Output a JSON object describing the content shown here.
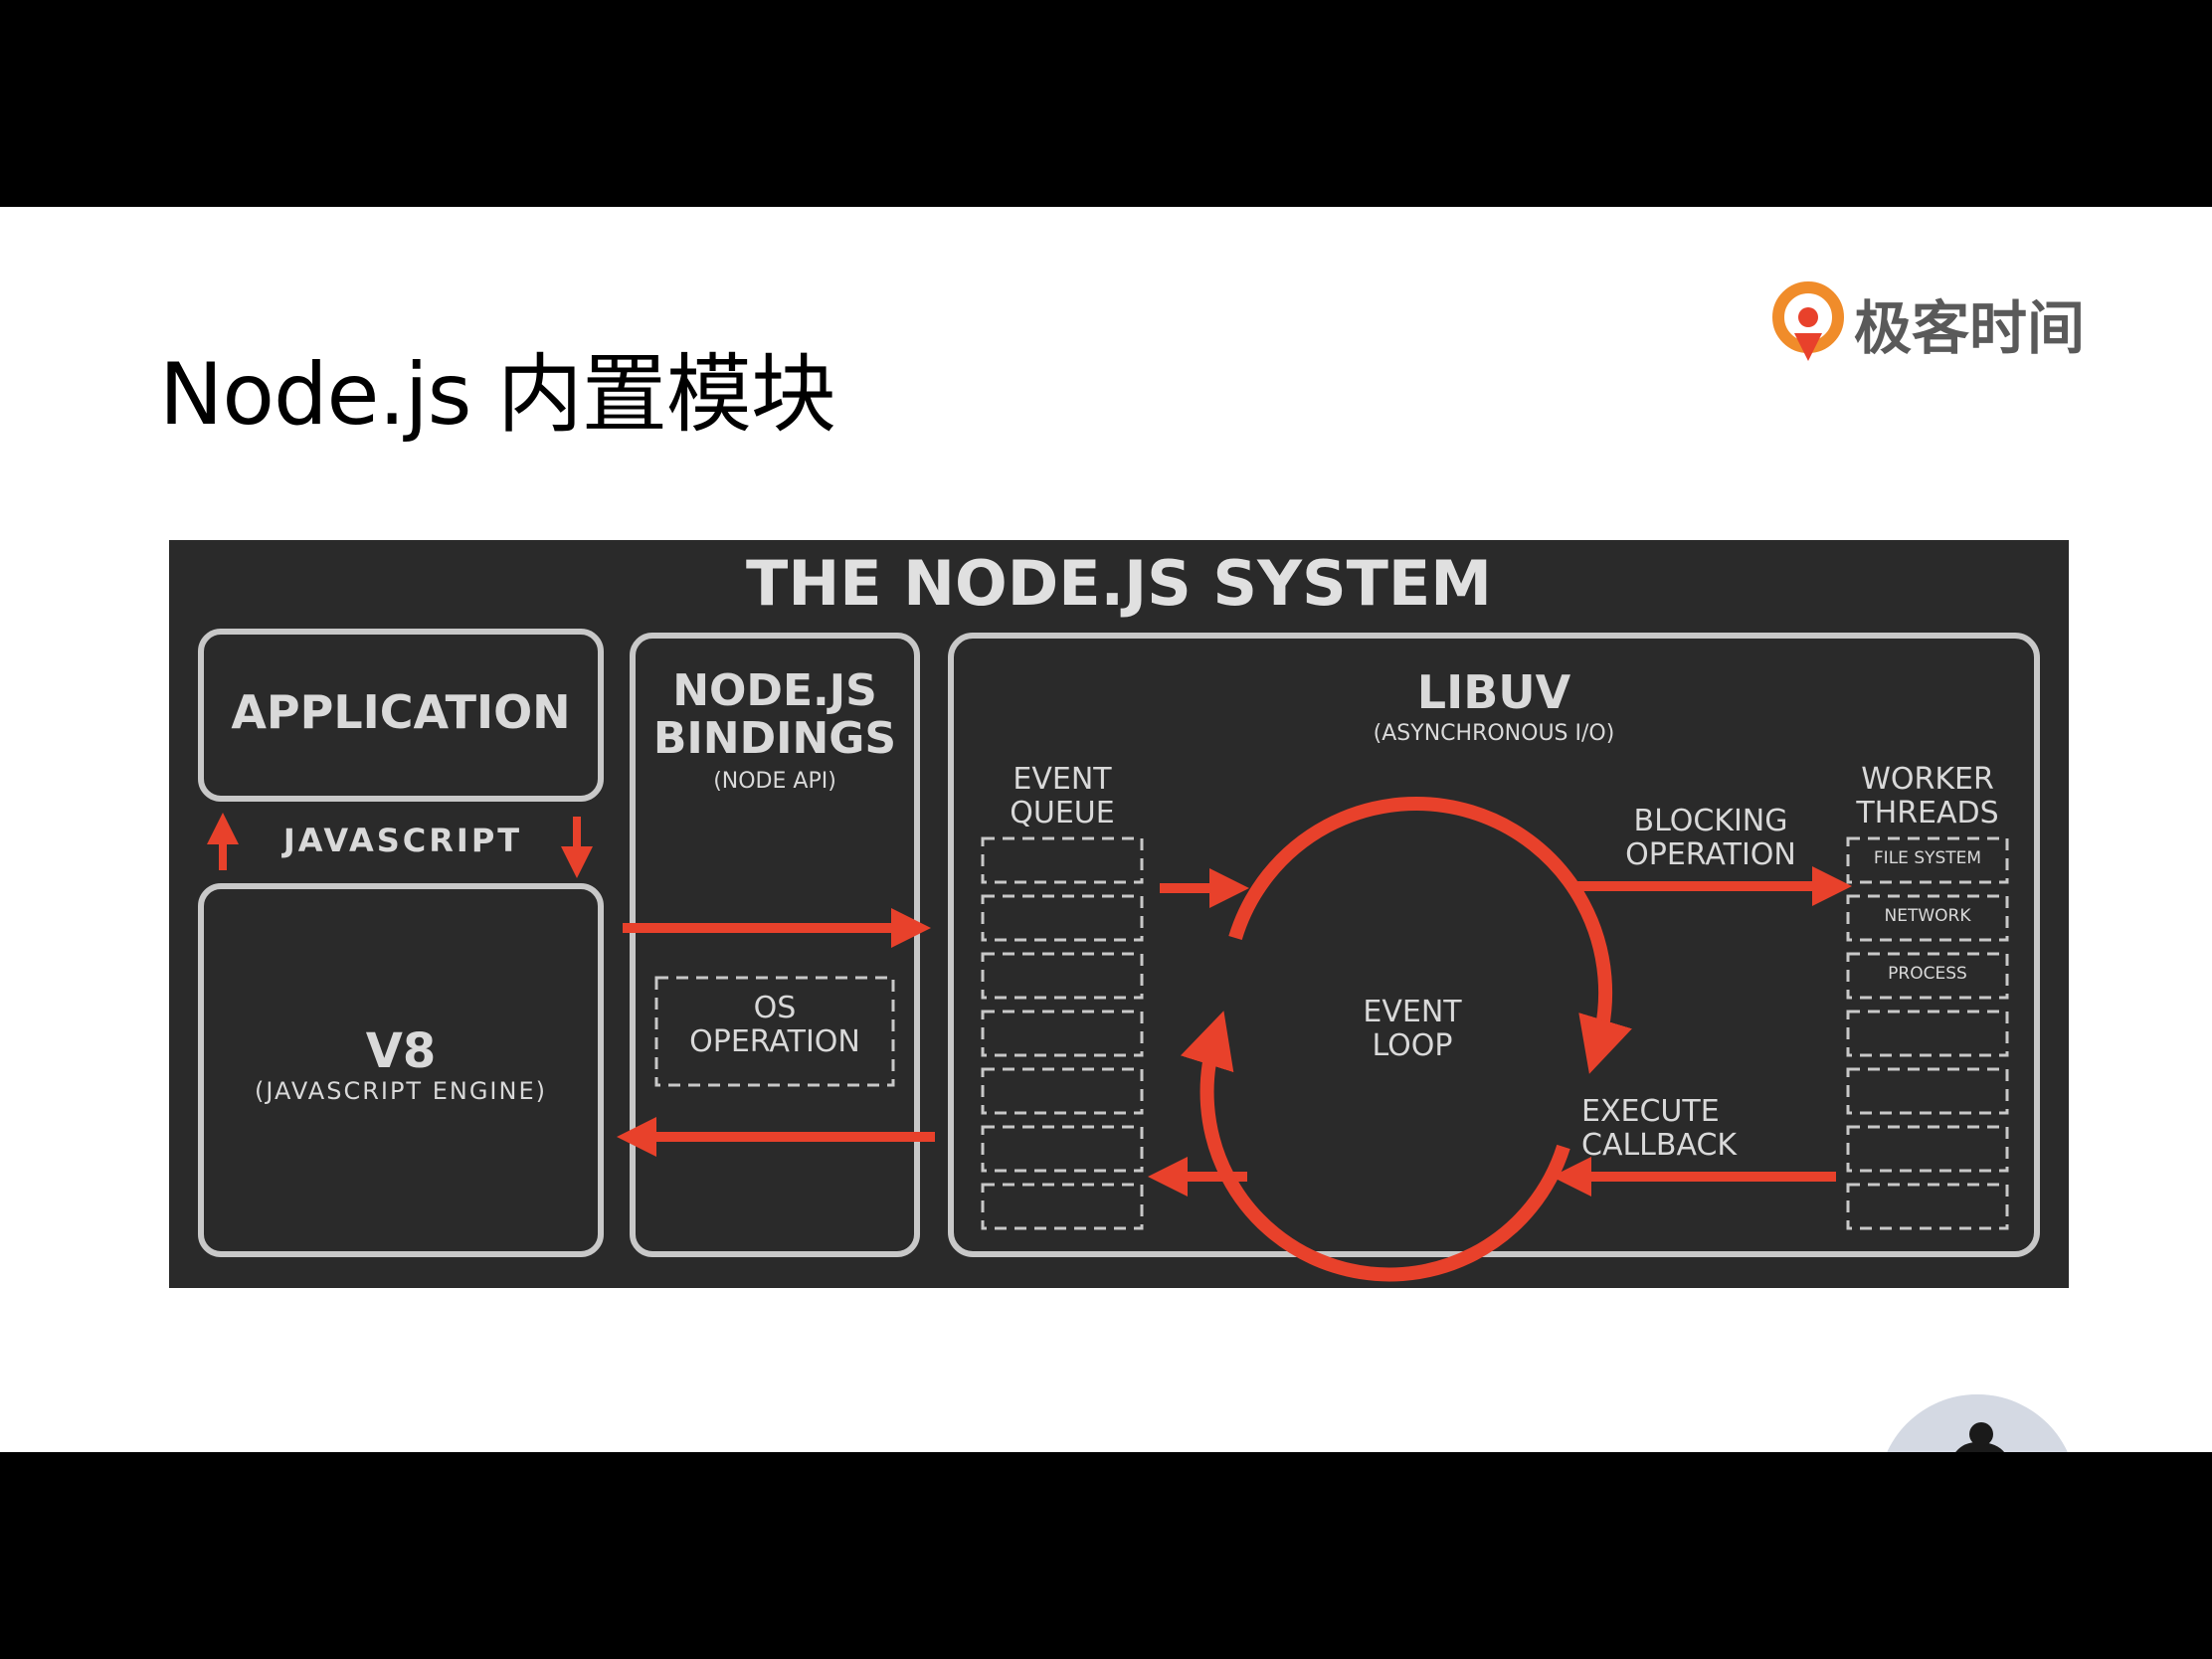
{
  "slide": {
    "title": "Node.js 内置模块",
    "brand": "极客时间"
  },
  "diagram": {
    "title": "THE NODE.JS SYSTEM",
    "application": "APPLICATION",
    "javascript": "JAVASCRIPT",
    "v8": "V8",
    "v8_sub": "(JAVASCRIPT ENGINE)",
    "bindings_line1": "NODE.JS",
    "bindings_line2": "BINDINGS",
    "bindings_sub": "(NODE API)",
    "os_line1": "OS",
    "os_line2": "OPERATION",
    "libuv": "LIBUV",
    "libuv_sub": "(ASYNCHRONOUS I/O)",
    "event_queue_line1": "EVENT",
    "event_queue_line2": "QUEUE",
    "event_loop_line1": "EVENT",
    "event_loop_line2": "LOOP",
    "blocking_line1": "BLOCKING",
    "blocking_line2": "OPERATION",
    "execute_line1": "EXECUTE",
    "execute_line2": "CALLBACK",
    "worker_line1": "WORKER",
    "worker_line2": "THREADS",
    "worker_slots": [
      "FILE SYSTEM",
      "NETWORK",
      "PROCESS"
    ]
  },
  "colors": {
    "accent": "#e8412b",
    "diagram_bg": "#2a2a2a",
    "stroke": "#c8c8c8",
    "brand_orange": "#f08c2a"
  },
  "icons": {
    "brand_logo": "geektime-logo-icon"
  }
}
